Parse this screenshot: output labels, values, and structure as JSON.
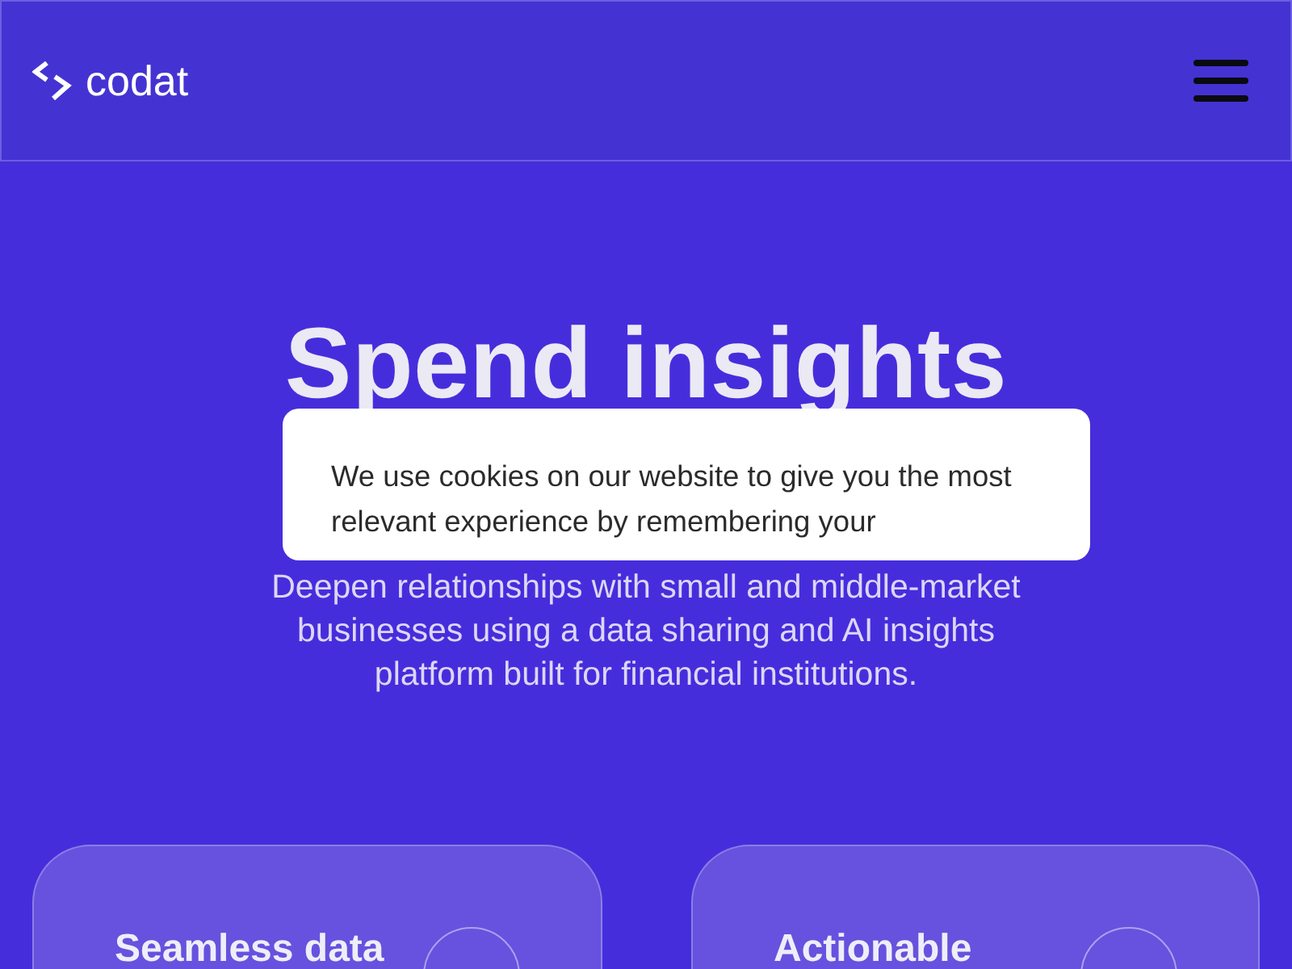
{
  "header": {
    "logo_text": "codat"
  },
  "hero": {
    "title": "Spend insights",
    "subtitle": "Deepen relationships with small and middle-market businesses using a data sharing and AI insights platform built for financial institutions."
  },
  "cookie_banner": {
    "text": "We use cookies on our website to give you the most relevant experience by remembering your"
  },
  "cards": [
    {
      "title": "Seamless data"
    },
    {
      "title": "Actionable"
    }
  ]
}
